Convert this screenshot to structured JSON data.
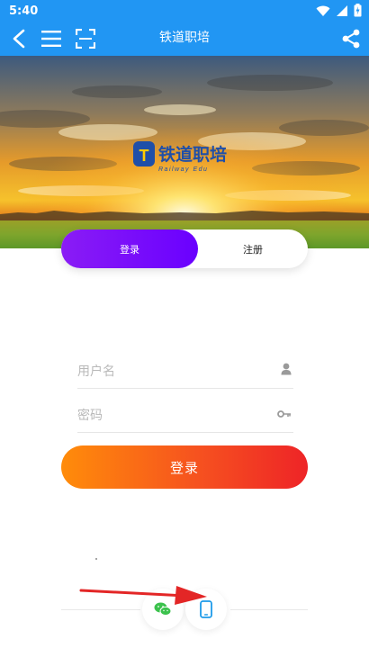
{
  "status": {
    "time": "5:40"
  },
  "app_bar": {
    "title": "铁道职培"
  },
  "banner": {
    "logo_text": "铁道职培",
    "logo_sub": "Railway Edu",
    "logo_mark": "T"
  },
  "tabs": [
    {
      "label": "登录",
      "active": true
    },
    {
      "label": "注册",
      "active": false
    }
  ],
  "form": {
    "username_placeholder": "用户名",
    "password_placeholder": "密码",
    "submit_label": "登录"
  },
  "bottom": {
    "options": [
      "wechat-icon",
      "phone-icon"
    ]
  },
  "colors": {
    "primary": "#2196f3",
    "tab_active": "#7a10ff",
    "button_start": "#ff8c0a",
    "button_end": "#ee2427",
    "arrow": "#e32626"
  }
}
